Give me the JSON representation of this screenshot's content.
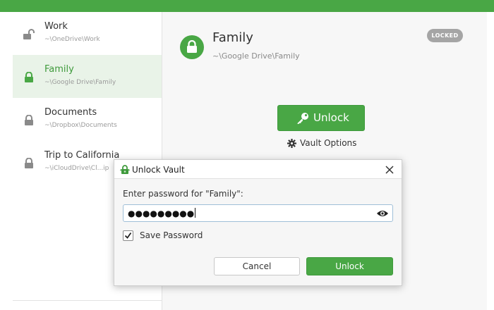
{
  "colors": {
    "accent": "#49a745",
    "selected_bg": "#e9f3e8",
    "badge": "#a5a5a5"
  },
  "sidebar": {
    "items": [
      {
        "name": "Work",
        "path": "~\\OneDrive\\Work",
        "icon": "lock-open-icon"
      },
      {
        "name": "Family",
        "path": "~\\Google Drive\\Family",
        "icon": "lock-icon",
        "selected": true
      },
      {
        "name": "Documents",
        "path": "~\\Dropbox\\Documents",
        "icon": "lock-icon"
      },
      {
        "name": "Trip to California",
        "path": "~\\iCloudDrive\\Cl...ip",
        "icon": "lock-icon"
      }
    ]
  },
  "main": {
    "title": "Family",
    "path": "~\\Google Drive\\Family",
    "badge": "LOCKED",
    "unlock_label": "Unlock",
    "options_label": "Vault Options"
  },
  "dialog": {
    "title": "Unlock Vault",
    "prompt": "Enter password for \"Family\":",
    "password_masked": "●●●●●●●●●",
    "save_password_label": "Save Password",
    "save_password_checked": true,
    "cancel_label": "Cancel",
    "unlock_label": "Unlock"
  }
}
